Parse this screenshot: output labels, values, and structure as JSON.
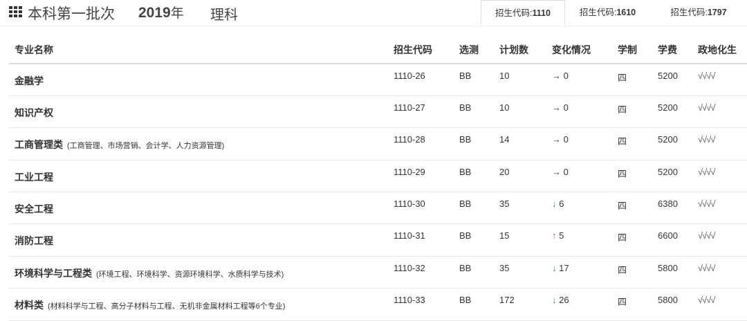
{
  "header": {
    "menu_icon": "grid-menu-icon",
    "batch": "本科第一批次",
    "year_num": "2019",
    "year_suffix": "年",
    "subject": "理科"
  },
  "tabs": [
    {
      "label": "招生代码:",
      "code": "1110",
      "active": true
    },
    {
      "label": "招生代码:",
      "code": "1610",
      "active": false
    },
    {
      "label": "招生代码:",
      "code": "1797",
      "active": false
    }
  ],
  "table": {
    "columns": [
      "专业名称",
      "招生代码",
      "选测",
      "计划数",
      "变化情况",
      "学制",
      "学费",
      "政地化生"
    ],
    "rows": [
      {
        "name": "金融学",
        "sub": "",
        "code": "1110-26",
        "test": "BB",
        "plan": "10",
        "change_arrow": "→",
        "change_dir": "flat",
        "change_val": "0",
        "years": "四",
        "fee": "5200",
        "subjects": "√√√√"
      },
      {
        "name": "知识产权",
        "sub": "",
        "code": "1110-27",
        "test": "BB",
        "plan": "10",
        "change_arrow": "→",
        "change_dir": "flat",
        "change_val": "0",
        "years": "四",
        "fee": "5200",
        "subjects": "√√√√"
      },
      {
        "name": "工商管理类",
        "sub": "(工商管理、市场营销、会计学、人力资源管理)",
        "code": "1110-28",
        "test": "BB",
        "plan": "14",
        "change_arrow": "→",
        "change_dir": "flat",
        "change_val": "0",
        "years": "四",
        "fee": "5200",
        "subjects": "√√√√"
      },
      {
        "name": "工业工程",
        "sub": "",
        "code": "1110-29",
        "test": "BB",
        "plan": "20",
        "change_arrow": "→",
        "change_dir": "flat",
        "change_val": "0",
        "years": "四",
        "fee": "5200",
        "subjects": "√√√√"
      },
      {
        "name": "安全工程",
        "sub": "",
        "code": "1110-30",
        "test": "BB",
        "plan": "35",
        "change_arrow": "↓",
        "change_dir": "down",
        "change_val": "6",
        "years": "四",
        "fee": "6380",
        "subjects": "√√√√"
      },
      {
        "name": "消防工程",
        "sub": "",
        "code": "1110-31",
        "test": "BB",
        "plan": "15",
        "change_arrow": "↑",
        "change_dir": "up",
        "change_val": "5",
        "years": "四",
        "fee": "6600",
        "subjects": "√√√√"
      },
      {
        "name": "环境科学与工程类",
        "sub": "(环境工程、环境科学、资源环境科学、水质科学与技术)",
        "code": "1110-32",
        "test": "BB",
        "plan": "35",
        "change_arrow": "↓",
        "change_dir": "down",
        "change_val": "17",
        "years": "四",
        "fee": "5800",
        "subjects": "√√√√"
      },
      {
        "name": "材料类",
        "sub": "(材料科学与工程、高分子材料与工程、无机非金属材料工程等6个专业)",
        "code": "1110-33",
        "test": "BB",
        "plan": "172",
        "change_arrow": "↓",
        "change_dir": "down",
        "change_val": "26",
        "years": "四",
        "fee": "5800",
        "subjects": "√√√√"
      }
    ]
  },
  "colors": {
    "up": "#d9534f",
    "down": "#3a7bd5",
    "flat": "#333333"
  }
}
